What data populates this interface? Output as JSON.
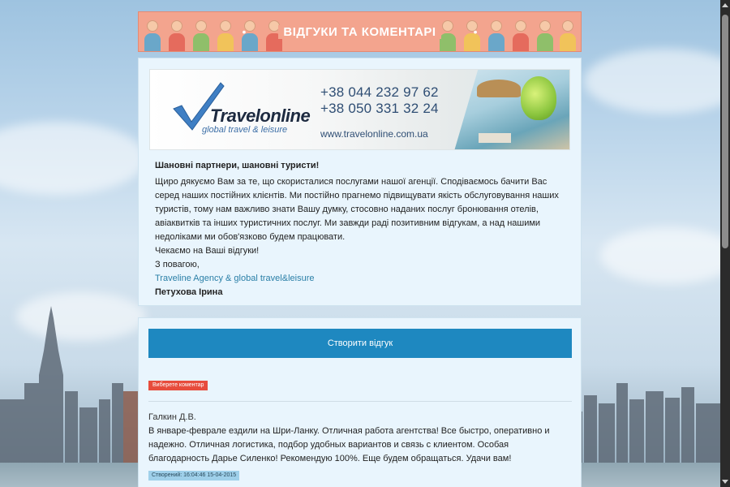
{
  "banner": {
    "title": "ВІДГУКИ ТА КОМЕНТАРІ",
    "dot": "•",
    "color": "#f3a48e"
  },
  "ad": {
    "brand": "Travelonline",
    "tagline": "global travel & leisure",
    "phone1": "+38 044  232 97 62",
    "phone2": "+38 050  331 32 24",
    "website": "www.travelonline.com.ua"
  },
  "intro": {
    "greeting": "Шановні партнери, шановні туристи!",
    "body": "Щиро дякуємо Вам за те, що скористалися послугами нашої агенції. Сподіваємось бачити Вас серед наших постійних клієнтів. Ми постійно прагнемо підвищувати якість обслуговування наших туристів, тому нам важливо знати Вашу думку, стосовно наданих послуг бронювання отелів, авіаквитків та інших туристичних послуг. Ми завжди раді позитивним відгукам, а над нашими недоліками ми обов'язково будем працювати.",
    "request": "Чекаємо на Ваші відгуки!",
    "regards": "З повагою,",
    "company": "Traveline Agency & global travel&leisure",
    "signature": "Петухова Ірина"
  },
  "reviews_section": {
    "create_button": "Створити відгук",
    "select_comment": "Виберете коментар",
    "button_color": "#1e88c0",
    "badge_color": "#e74c3c",
    "items": [
      {
        "author": "Галкин Д.В.",
        "text": "В январе-феврале ездили на Шри-Ланку. Отличная работа агентства! Все быстро, оперативно и надежно. Отличная логистика, подбор удобных вариантов и связь с клиентом. Особая благодарность Дарье Силенко! Рекомендую 100%. Еще будем обращаться. Удачи вам!",
        "created": "Створений: 16:04:46 15-04-2015"
      }
    ]
  }
}
